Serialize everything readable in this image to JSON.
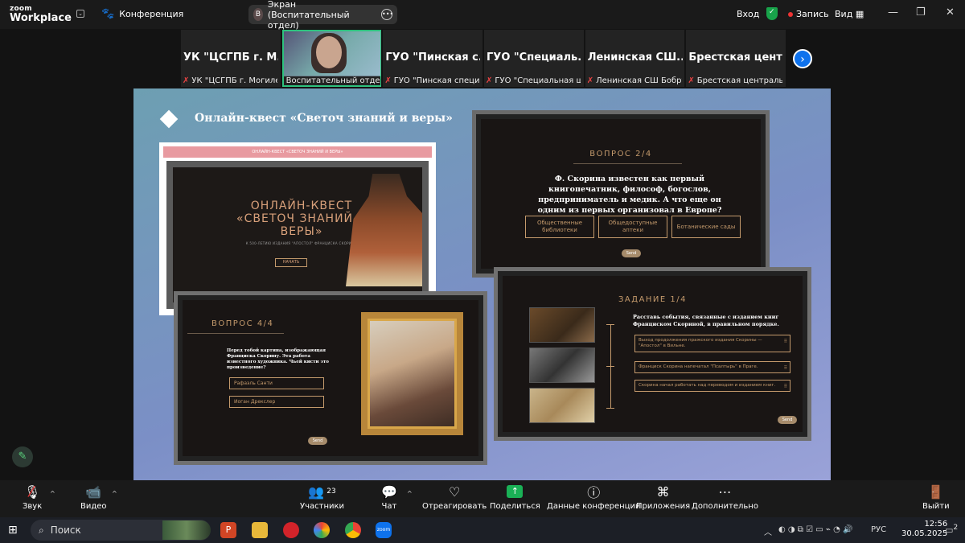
{
  "topbar": {
    "logo_line1": "zoom",
    "logo_line2": "Workplace",
    "meeting_label": "Конференция",
    "screen_pill": {
      "avatar": "В",
      "label": "Экран (Воспитательный отдел)"
    },
    "login": "Вход",
    "record": "Запись",
    "view": "Вид"
  },
  "participants": [
    {
      "name": "УК \"ЦСГПБ г. М...",
      "label": "УК \"ЦСГПБ г. Могилев..."
    },
    {
      "name": "",
      "label": "Воспитательный отдел",
      "active": true
    },
    {
      "name": "ГУО \"Пинская с...",
      "label": "ГУО \"Пинская специа..."
    },
    {
      "name": "ГУО \"Специаль...",
      "label": "ГУО \"Специальная шк..."
    },
    {
      "name": "Ленинская СШ...",
      "label": "Ленинская СШ Бобру..."
    },
    {
      "name": "Брестская цент...",
      "label": "Брестская центральна..."
    }
  ],
  "slide": {
    "title": "Онлайн-квест «Светоч знаний и веры»",
    "card1": {
      "bar": "ОНЛАЙН-КВЕСТ «СВЕТОЧ ЗНАНИЙ И ВЕРЫ»",
      "title_line1": "ОНЛАЙН-КВЕСТ",
      "title_line2": "«СВЕТОЧ ЗНАНИЙ И ВЕРЫ»",
      "subtitle": "К 500-ЛЕТИЮ ИЗДАНИЯ \"АПОСТОЛ\" ФРАНЦИСКА СКОРИНЫ",
      "start": "НАЧАТЬ"
    },
    "card2": {
      "heading": "ВОПРОС 2/4",
      "question": "Ф. Скорина известен как первый книгопечатник, философ, богослов, предприниматель и медик. А что еще он одним из первых организовал в Европе?",
      "options": [
        "Общественные библиотеки",
        "Общедоступные аптеки",
        "Ботанические сады"
      ],
      "send": "Send"
    },
    "card3": {
      "heading": "ВОПРОС 4/4",
      "question": "Перед тобой картина, изображающая Франциска Скорину. Эта работа известного художника. Чьей кисти это произведение?",
      "options": [
        "Рафаэль Санти",
        "Иоган Дрекслер"
      ],
      "send": "Send"
    },
    "card4": {
      "heading": "ЗАДАНИЕ 1/4",
      "task": "Расставь события, связанные с изданием книг Франциском Скориной, в правильном порядке.",
      "items": [
        "Выход продолжения пражского издания Скорины — \"Апостол\" в Вильне.",
        "Франциск Скорина напечатал \"Псалтырь\" в Праге.",
        "Скорина начал работать над переводом и изданием книг."
      ],
      "send": "Send"
    }
  },
  "toolbar": {
    "audio": "Звук",
    "video": "Видео",
    "participants": "Участники",
    "participants_count": "23",
    "chat": "Чат",
    "react": "Отреагировать",
    "share": "Поделиться",
    "info": "Данные конференции",
    "apps": "Приложения",
    "more": "Дополнительно",
    "leave": "Выйти"
  },
  "taskbar": {
    "search": "Поиск",
    "lang": "РУС",
    "time": "12:56",
    "date": "30.05.2025",
    "badge": "2"
  },
  "colors": {
    "accent": "#0e72ed",
    "share": "#1ab156",
    "quest_gold": "#c49a6c"
  }
}
